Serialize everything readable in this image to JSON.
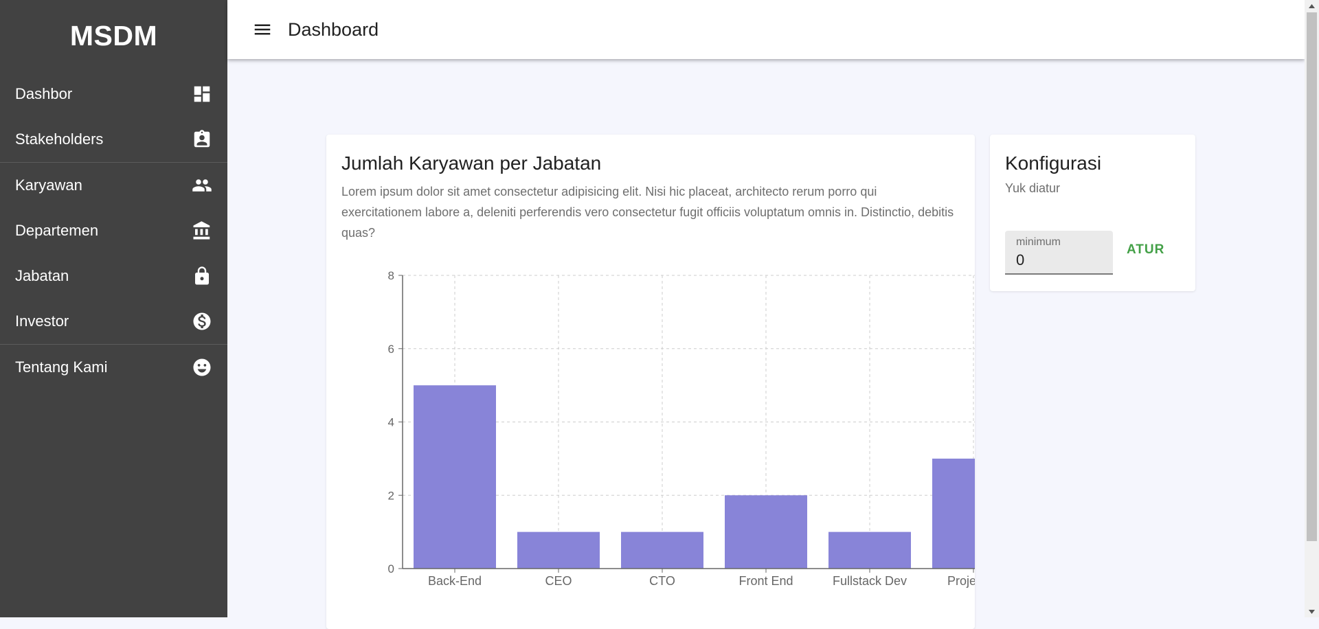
{
  "sidebar": {
    "brand": "MSDM",
    "items": [
      {
        "label": "Dashbor",
        "icon": "dashboard-icon"
      },
      {
        "label": "Stakeholders",
        "icon": "assignment-ind-icon"
      },
      {
        "label": "Karyawan",
        "icon": "people-icon"
      },
      {
        "label": "Departemen",
        "icon": "bank-icon"
      },
      {
        "label": "Jabatan",
        "icon": "lock-icon"
      },
      {
        "label": "Investor",
        "icon": "dollar-circle-icon"
      },
      {
        "label": "Tentang Kami",
        "icon": "smile-icon"
      }
    ]
  },
  "header": {
    "menu_icon": "hamburger-menu-icon",
    "title": "Dashboard"
  },
  "chart_card": {
    "title": "Jumlah Karyawan per Jabatan",
    "description": "Lorem ipsum dolor sit amet consectetur adipisicing elit. Nisi hic placeat, architecto rerum porro qui exercitationem labore a, deleniti perferendis vero consectetur fugit officiis voluptatum omnis in. Distinctio, debitis quas?"
  },
  "config_card": {
    "title": "Konfigurasi",
    "subtitle": "Yuk diatur",
    "min_label": "minimum",
    "min_value": "0",
    "button_label": "ATUR"
  },
  "colors": {
    "sidebar_bg": "#424242",
    "bar_fill": "#8884d8",
    "accent_green": "#43a047",
    "page_bg": "#f5f6fd"
  },
  "chart_data": {
    "type": "bar",
    "categories": [
      "Back-End",
      "CEO",
      "CTO",
      "Front End",
      "Fullstack Dev",
      "Project M"
    ],
    "values": [
      5,
      1,
      1,
      2,
      1,
      3
    ],
    "yticks": [
      0,
      2,
      4,
      6,
      8
    ],
    "ylim": [
      0,
      8
    ],
    "grid": true,
    "title": "",
    "xlabel": "",
    "ylabel": ""
  }
}
